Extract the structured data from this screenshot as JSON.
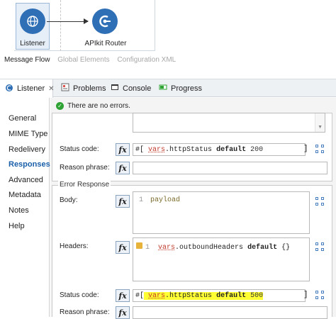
{
  "canvas": {
    "listener_label": "Listener",
    "router_label": "APIkit Router",
    "tabs": [
      "Message Flow",
      "Global Elements",
      "Configuration XML"
    ]
  },
  "view_tabs": {
    "listener": "Listener",
    "problems": "Problems",
    "console": "Console",
    "progress": "Progress"
  },
  "nav": {
    "items": [
      "General",
      "MIME Type",
      "Redelivery",
      "Responses",
      "Advanced",
      "Metadata",
      "Notes",
      "Help"
    ],
    "active": "Responses"
  },
  "status_message": "There are no errors.",
  "response": {
    "status_code_label": "Status code:",
    "status_code_prefix": "#[",
    "status_code_vars": "vars",
    "status_code_rest": ".httpStatus",
    "status_code_default": "default",
    "status_code_value": "200",
    "status_code_suffix": "]",
    "reason_phrase_label": "Reason phrase:"
  },
  "error_response": {
    "title": "Error Response",
    "body_label": "Body:",
    "body_line_no": "1",
    "body_code": "payload",
    "headers_label": "Headers:",
    "headers_line_no": "1",
    "headers_vars": "vars",
    "headers_rest": ".outboundHeaders",
    "headers_default": "default",
    "headers_value": "{}",
    "status_code_label": "Status code:",
    "status_code_prefix": "#[",
    "status_code_vars": "vars",
    "status_code_rest": ".httpStatus",
    "status_code_default": "default",
    "status_code_value": "500",
    "status_code_suffix": "]",
    "reason_phrase_label": "Reason phrase:"
  },
  "fx_label": "fx",
  "colors": {
    "accent": "#2f6fb5",
    "ok": "#2fa334",
    "highlight": "#ffff33",
    "vars_red": "#c0392b"
  }
}
